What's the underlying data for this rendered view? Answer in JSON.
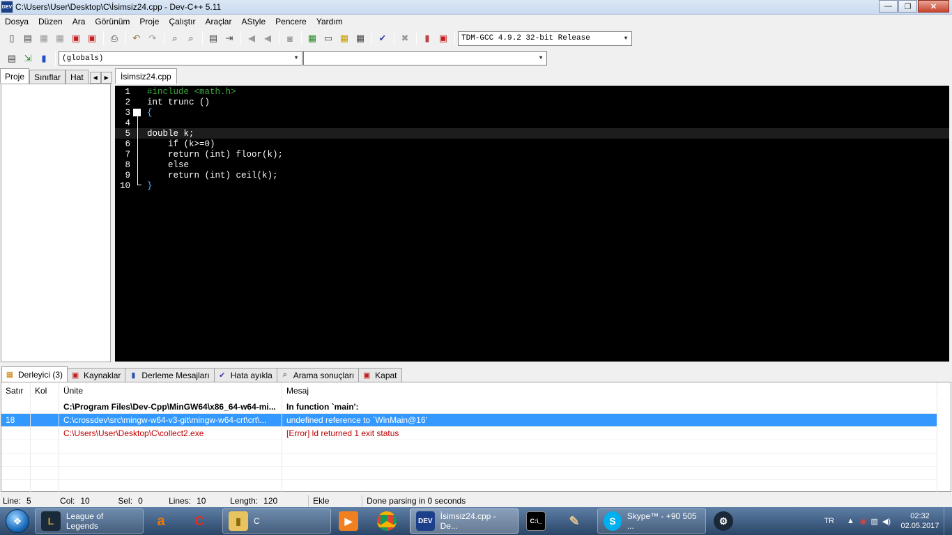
{
  "window": {
    "title": "C:\\Users\\User\\Desktop\\C\\İsimsiz24.cpp - Dev-C++ 5.11",
    "app_icon_text": "DEV",
    "buttons": {
      "minimize": "—",
      "maximize": "❐",
      "close": "✕"
    }
  },
  "menu": [
    "Dosya",
    "Düzen",
    "Ara",
    "Görünüm",
    "Proje",
    "Çalıştır",
    "Araçlar",
    "AStyle",
    "Pencere",
    "Yardım"
  ],
  "toolbar": {
    "compiler_select": "TDM-GCC 4.9.2 32-bit Release",
    "scope_select": "(globals)",
    "member_select": ""
  },
  "left_tabs": [
    "Proje",
    "Sınıflar",
    "Hat"
  ],
  "editor": {
    "tab_label": "İsimsiz24.cpp",
    "lines": [
      {
        "n": "1",
        "text": "#include <math.h>"
      },
      {
        "n": "2",
        "text": "int trunc ()"
      },
      {
        "n": "3",
        "text": "{"
      },
      {
        "n": "4",
        "text": ""
      },
      {
        "n": "5",
        "text": "double k;"
      },
      {
        "n": "6",
        "text": "    if (k>=0)"
      },
      {
        "n": "7",
        "text": "    return (int) floor(k);"
      },
      {
        "n": "8",
        "text": "    else"
      },
      {
        "n": "9",
        "text": "    return (int) ceil(k);"
      },
      {
        "n": "10",
        "text": "}"
      }
    ],
    "current_line": 5
  },
  "bottom_tabs": [
    {
      "label": "Derleyici (3)",
      "icon": "grid-icon"
    },
    {
      "label": "Kaynaklar",
      "icon": "resources-icon"
    },
    {
      "label": "Derleme Mesajları",
      "icon": "chart-icon"
    },
    {
      "label": "Hata ayıkla",
      "icon": "check-icon"
    },
    {
      "label": "Arama sonuçları",
      "icon": "search-icon"
    },
    {
      "label": "Kapat",
      "icon": "close-icon"
    }
  ],
  "output": {
    "headers": [
      "Satır",
      "Kol",
      "Ünite",
      "Mesaj"
    ],
    "rows": [
      {
        "line": "",
        "col": "",
        "unit": "C:\\Program Files\\Dev-Cpp\\MinGW64\\x86_64-w64-mi...",
        "message": "In function `main':",
        "style": "bold"
      },
      {
        "line": "18",
        "col": "",
        "unit": "C:\\crossdev\\src\\mingw-w64-v3-git\\mingw-w64-crt\\crt\\...",
        "message": "undefined reference to `WinMain@16'",
        "style": "selected"
      },
      {
        "line": "",
        "col": "",
        "unit": "C:\\Users\\User\\Desktop\\C\\collect2.exe",
        "message": "[Error] ld returned 1 exit status",
        "style": "error"
      }
    ]
  },
  "status": {
    "line_label": "Line:",
    "line_value": "5",
    "col_label": "Col:",
    "col_value": "10",
    "sel_label": "Sel:",
    "sel_value": "0",
    "lines_label": "Lines:",
    "lines_value": "10",
    "length_label": "Length:",
    "length_value": "120",
    "mode": "Ekle",
    "message": "Done parsing in 0 seconds"
  },
  "taskbar": {
    "items": [
      {
        "label": "League of Legends",
        "icon": "lol-icon"
      },
      {
        "label": "",
        "icon": "avast-icon"
      },
      {
        "label": "",
        "icon": "ccleaner-icon"
      },
      {
        "label": "C",
        "icon": "folder-icon"
      },
      {
        "label": "",
        "icon": "media-player-icon"
      },
      {
        "label": "",
        "icon": "chrome-icon"
      },
      {
        "label": "İsimsiz24.cpp - De...",
        "icon": "devcpp-icon"
      },
      {
        "label": "",
        "icon": "cmd-icon"
      },
      {
        "label": "",
        "icon": "paint-icon"
      },
      {
        "label": "Skype™ - +90 505 ...",
        "icon": "skype-icon"
      },
      {
        "label": "",
        "icon": "steam-icon"
      }
    ],
    "lang": "TR",
    "time": "02:32",
    "date": "02.05.2017"
  }
}
